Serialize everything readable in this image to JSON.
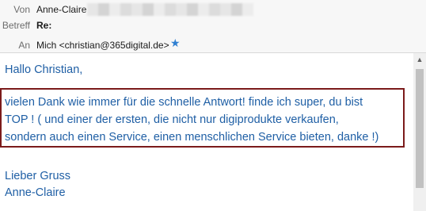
{
  "header": {
    "from_label": "Von",
    "from_name": "Anne-Claire",
    "subject_label": "Betreff",
    "subject_value": "Re:",
    "to_label": "An",
    "to_value": "Mich <christian@365digital.de>",
    "star_icon": "star-icon"
  },
  "message": {
    "greeting": "Hallo Christian,",
    "highlight_lines": [
      "vielen Dank wie immer für die schnelle Antwort! finde ich super, du bist",
      "TOP ! ( und einer der ersten, die nicht nur digiprodukte verkaufen,",
      "sondern auch einen Service, einen menschlichen Service bieten, danke !)"
    ],
    "closing": "Lieber Gruss",
    "signature": "Anne-Claire"
  },
  "colors": {
    "body_text": "#1f5fa5",
    "highlight_border": "#7b1b1b",
    "star": "#2f7fd1"
  }
}
